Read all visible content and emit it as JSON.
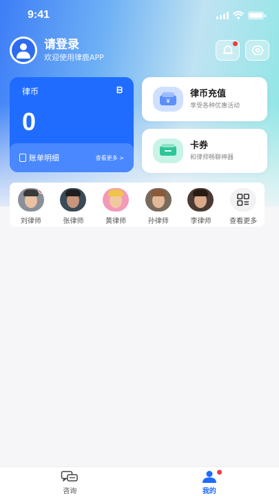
{
  "status": {
    "time": "9:41"
  },
  "user": {
    "name": "请登录",
    "subtitle": "欢迎使用律鹿APP"
  },
  "coin_card": {
    "title": "律币",
    "icon_glyph": "ᗷ",
    "value": "0",
    "bill_label": "账单明细",
    "more_label": "查看更多 >"
  },
  "recharge": {
    "title": "律币充值",
    "subtitle": "享受各种优惠活动",
    "icon_glyph": "¥"
  },
  "coupon": {
    "title": "卡券",
    "subtitle": "和律师畅聊神器"
  },
  "lawyers": [
    {
      "name": "刘律师",
      "has_dot": true
    },
    {
      "name": "张律师",
      "has_dot": false
    },
    {
      "name": "黄律师",
      "has_dot": false
    },
    {
      "name": "孙律师",
      "has_dot": false
    },
    {
      "name": "李律师",
      "has_dot": false
    }
  ],
  "lawyers_more_label": "查看更多",
  "tabs": [
    {
      "label": "咨询",
      "icon": "chat-bubbles-icon",
      "active": false
    },
    {
      "label": "我的",
      "icon": "person-icon",
      "active": true
    }
  ],
  "colors": {
    "primary": "#1f6cff",
    "badge": "#f23c3c",
    "coupon_accent": "#2ec59a"
  }
}
